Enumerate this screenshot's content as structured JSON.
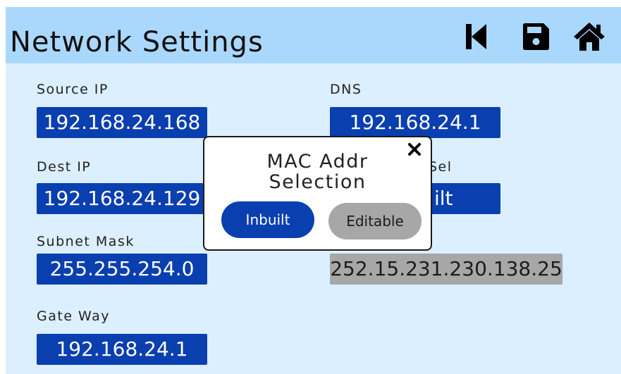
{
  "header": {
    "title": "Network Settings"
  },
  "toolbar": {
    "back_icon": "skip-back-icon",
    "save_icon": "save-icon",
    "home_icon": "home-icon"
  },
  "fields": {
    "source_ip": {
      "label": "Source IP",
      "value": "192.168.24.168"
    },
    "dest_ip": {
      "label": "Dest IP",
      "value": "192.168.24.129"
    },
    "subnet_mask": {
      "label": "Subnet Mask",
      "value": "255.255.254.0"
    },
    "gateway": {
      "label": "Gate Way",
      "value": "192.168.24.1"
    },
    "dns": {
      "label": "DNS",
      "value": "192.168.24.1"
    },
    "mac_sel": {
      "label_fragment": "Sel",
      "value_fragment": "ilt"
    },
    "mac_addr": {
      "value": "252.15.231.230.138.25"
    }
  },
  "popup": {
    "title_line1": "MAC Addr",
    "title_line2": "Selection",
    "inbuilt_label": "Inbuilt",
    "editable_label": "Editable",
    "close_icon": "close-icon"
  },
  "colors": {
    "header_bg": "#aad8fc",
    "screen_bg": "#dcefff",
    "field_blue": "#0a3fb0",
    "field_grey": "#a7a7a7"
  }
}
